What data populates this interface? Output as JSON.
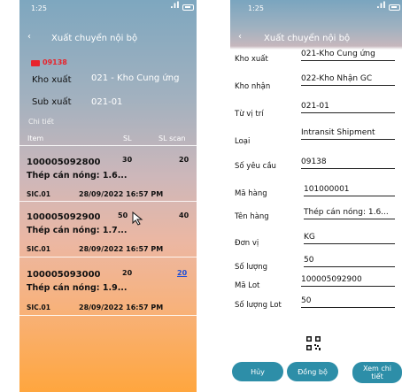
{
  "left": {
    "status": {
      "time": "1:25"
    },
    "nav": {
      "title": "Xuất chuyển nội bộ"
    },
    "doc_no": "09138",
    "fields": [
      {
        "label": "Kho xuất",
        "value": "021 - Kho Cung ứng"
      },
      {
        "label": "Sub xuất",
        "value": "021-01"
      }
    ],
    "section": "Chi tiết",
    "columns": {
      "item": "Item",
      "sl": "SL",
      "sl_scan": "SL scan"
    },
    "rows": [
      {
        "code": "100005092800",
        "sl": "30",
        "scan": "20",
        "name": "Thép cán nóng: 1.6...",
        "sub": "SIC.01",
        "time": "28/09/2022 16:57 PM"
      },
      {
        "code": "100005092900",
        "sl": "50",
        "scan": "40",
        "name": "Thép cán nóng: 1.7...",
        "sub": "SIC.01",
        "time": "28/09/2022 16:57 PM"
      },
      {
        "code": "100005093000",
        "sl": "20",
        "scan": "20",
        "name": "Thép cán nóng: 1.9...",
        "sub": "SIC.01",
        "time": "28/09/2022 16:57 PM"
      }
    ],
    "colors": {
      "doc_no": "#e8232b",
      "scan_link": "#1f4fd6"
    }
  },
  "right": {
    "status": {
      "time": "1:25"
    },
    "nav": {
      "title": "Xuất chuyển nội bộ"
    },
    "fields": [
      {
        "label": "Kho xuất",
        "value": "021-Kho Cung ứng"
      },
      {
        "label": "Kho nhận",
        "value": "022-Kho Nhận GC"
      },
      {
        "label": "Từ vị trí",
        "value": "021-01"
      },
      {
        "label": "Loại",
        "value": "Intransit Shipment"
      },
      {
        "label": "Số yêu cầu",
        "value": "09138"
      },
      {
        "label": "Mã hàng",
        "value": "101000001"
      },
      {
        "label": "Tên hàng",
        "value": "Thép cán nóng: 1.6..."
      },
      {
        "label": "Đơn vị",
        "value": "KG"
      },
      {
        "label": "Số lượng",
        "value": "50"
      },
      {
        "label": "Mã Lot",
        "value": "100005092900"
      },
      {
        "label": "Số lượng Lot",
        "value": "50"
      }
    ],
    "buttons": {
      "cancel": "Hủy",
      "sync": "Đồng bộ",
      "detail": "Xem chi tiết"
    },
    "colors": {
      "button": "#2d8ea8"
    }
  }
}
